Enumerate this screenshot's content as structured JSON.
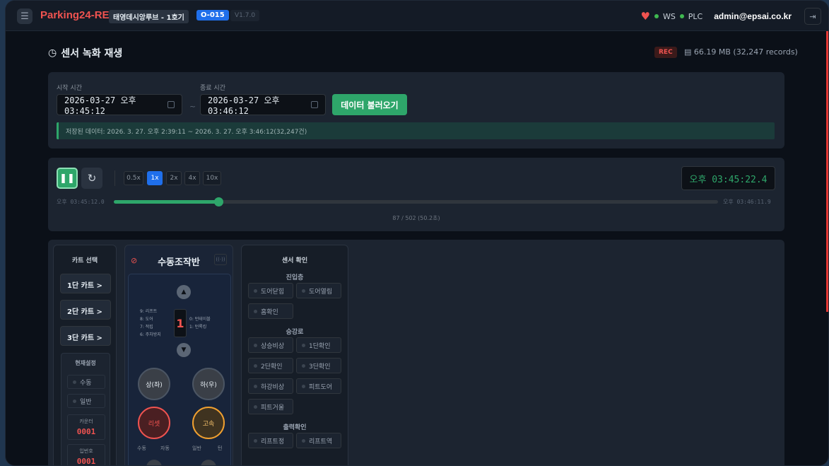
{
  "header": {
    "menu_icon": "menu-icon",
    "brand": "Parking24-RE",
    "site": "태영데시앙루브 - 1호기",
    "code": "O-015",
    "version": "V1.7.0",
    "ws_label": "WS",
    "plc_label": "PLC",
    "user": "admin@epsai.co.kr",
    "accent": "#ef5350"
  },
  "page": {
    "title": "센서 녹화 재생",
    "rec_badge": "REC",
    "storage": "66.19 MB (32,247 records)"
  },
  "range": {
    "start_label": "시작 시간",
    "start_value": "2026-03-27 오후 03:45:12",
    "end_label": "종료 시간",
    "end_value": "2026-03-27 오후 03:46:12",
    "separator": "~",
    "load_button": "데이터 불러오기",
    "info": "저장된 데이터: 2026. 3. 27. 오후 2:39:11 ~ 2026. 3. 27. 오후 3:46:12(32,247건)"
  },
  "player": {
    "speeds": [
      "0.5x",
      "1x",
      "2x",
      "4x",
      "10x"
    ],
    "active_speed": "1x",
    "clock": "오후 03:45:22.4",
    "time_start": "오후 03:45:12.0",
    "time_end": "오후 03:46:11.9",
    "frame_info": "87 / 502 (50.2초)",
    "progress": 0.173
  },
  "cart": {
    "title": "카트 선택",
    "buttons": [
      "1단 카트 >",
      "2단 카트 >",
      "3단 카트 >"
    ],
    "settings_title": "현재설정",
    "mode_manual": "수동",
    "mode_normal": "일반",
    "counter_label": "카운터",
    "counter_value": "0001",
    "slot_label": "입번호",
    "slot_value": "0001"
  },
  "manual": {
    "title": "수동조작반",
    "floor": "1",
    "left_legend": [
      "9: 리프트",
      "8: 도어",
      "7: 적립",
      "6: 주차방지"
    ],
    "right_legend": [
      "0: 턴테이블",
      "1: 턴록킹"
    ],
    "up_button": "상(좌)",
    "down_button": "하(우)",
    "reset_button": "리셋",
    "fast_button": "고속",
    "mode_labels": [
      "수동",
      "자동",
      "일반",
      "턴"
    ]
  },
  "sensor": {
    "title": "센서 확인",
    "sections": [
      {
        "name": "진입층",
        "items": [
          "도어닫힘",
          "도어열림",
          "홈확인"
        ]
      },
      {
        "name": "승강로",
        "items": [
          "상승비상",
          "1단확인",
          "2단확인",
          "3단확인",
          "하강비상",
          "피트도어",
          "피트거울"
        ]
      },
      {
        "name": "출력확인",
        "items": [
          "리프트정",
          "리프트역"
        ]
      }
    ]
  }
}
